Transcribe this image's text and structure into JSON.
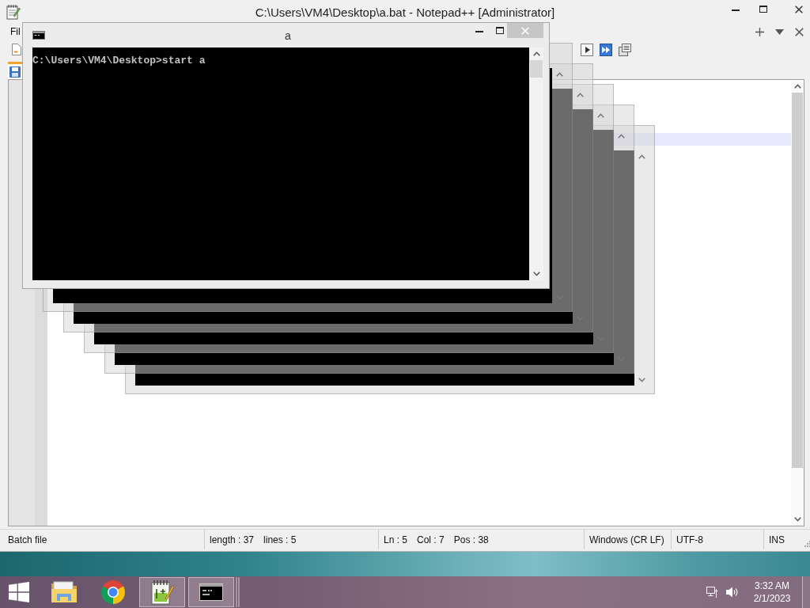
{
  "notepad_window": {
    "title": "C:\\Users\\VM4\\Desktop\\a.bat - Notepad++ [Administrator]",
    "menu": [
      "Fil"
    ],
    "tabs": [
      {
        "selected": true
      }
    ],
    "status_bar": {
      "sections": [
        {
          "items": [
            "Batch file"
          ]
        },
        {
          "items": [
            "length : 37",
            "lines : 5"
          ]
        },
        {
          "items": [
            "Ln : 5",
            "Col : 7",
            "Pos : 38"
          ]
        },
        {
          "items": [
            "Windows (CR LF)"
          ]
        },
        {
          "items": [
            "UTF-8"
          ]
        },
        {
          "items": [
            "INS"
          ]
        }
      ]
    }
  },
  "console_window": {
    "title": "a",
    "lines": [
      "C:\\Users\\VM4\\Desktop>start a"
    ]
  },
  "taskbar": {
    "apps": [
      {
        "kind": "folder",
        "running": false
      },
      {
        "kind": "browser",
        "running": false
      },
      {
        "kind": "notepad",
        "running": true
      },
      {
        "kind": "terminal",
        "running": true
      }
    ],
    "clock": {
      "time": "3:32 AM",
      "date": "2/1/2023"
    }
  }
}
